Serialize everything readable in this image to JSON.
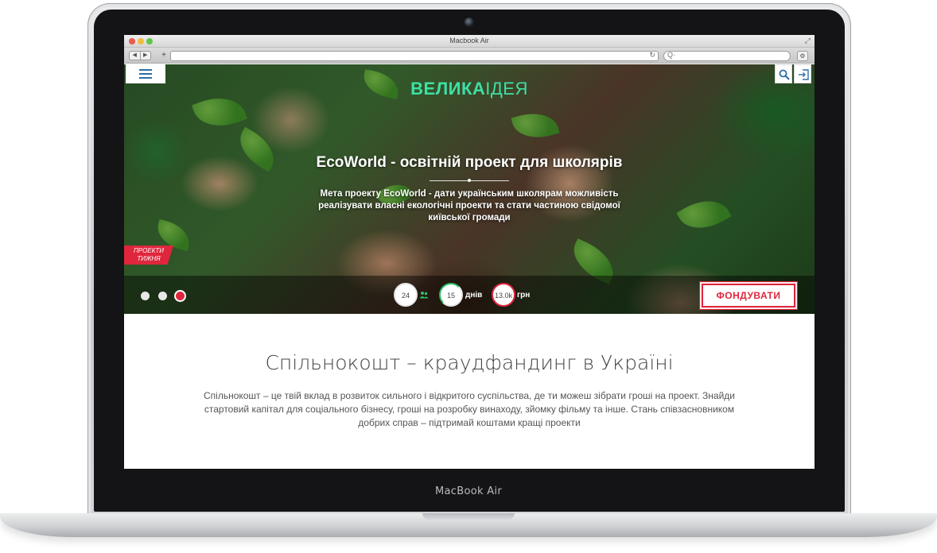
{
  "device": {
    "label": "MacBook Air"
  },
  "browser": {
    "window_title": "Macbook Air",
    "back_glyph": "◀",
    "forward_glyph": "▶",
    "add_tab_glyph": "+",
    "reload_glyph": "↻",
    "search_glyph": "Q·",
    "gear_glyph": "⚙",
    "resize_glyph": "⤢"
  },
  "site": {
    "logo_bold": "ВЕЛИКА",
    "logo_light": "ІДЕЯ",
    "accent_color": "#3de0a5",
    "brand_red": "#e0263c"
  },
  "hero": {
    "title": "EcoWorld - освітній проект для школярів",
    "description": "Мета проекту EcoWorld - дати українським школярам можливість реалізувати власні екологічні проекти та стати частиною свідомої київської громади",
    "badge_line1": "ПРОЕКТИ",
    "badge_line2": "ТИЖНЯ",
    "slides": 3,
    "active_slide": 3,
    "stats": {
      "supporters": "24",
      "days": "15",
      "days_unit": "днів",
      "amount": "13.0k",
      "amount_unit": "грн"
    },
    "fund_button": "ФОНДУВАТИ"
  },
  "content": {
    "title": "Спільнокошт – краудфандинг в Україні",
    "text": "Спільнокошт – це твій вклад в розвиток сильного і відкритого суспільства, де ти можеш зібрати гроші на проект. Знайди стартовий капітал для соціального бізнесу, гроші на розробку винаходу, зйомку фільму та інше. Стань співзасновником добрих справ – підтримай коштами кращі проекти"
  },
  "icons": [
    "menu-icon",
    "search-icon",
    "login-icon",
    "people-icon",
    "camera-icon"
  ]
}
